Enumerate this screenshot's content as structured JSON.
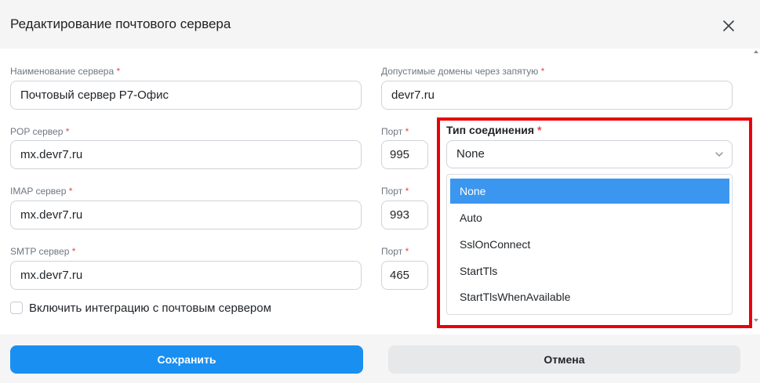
{
  "dialog": {
    "title": "Редактирование почтового сервера"
  },
  "form": {
    "server_name": {
      "label": "Наименование сервера",
      "value": "Почтовый сервер Р7-Офис"
    },
    "domains": {
      "label": "Допустимые домены через запятую",
      "value": "devr7.ru"
    },
    "pop": {
      "label": "POP сервер",
      "value": "mx.devr7.ru",
      "port_label": "Порт",
      "port": "995"
    },
    "imap": {
      "label": "IMAP сервер",
      "value": "mx.devr7.ru",
      "port_label": "Порт",
      "port": "993"
    },
    "smtp": {
      "label": "SMTP сервер",
      "value": "mx.devr7.ru",
      "port_label": "Порт",
      "port": "465"
    },
    "required_mark": "*",
    "connection_type": {
      "label": "Тип соединения",
      "selected": "None",
      "options": [
        "None",
        "Auto",
        "SslOnConnect",
        "StartTls",
        "StartTlsWhenAvailable"
      ]
    },
    "integration_checkbox": {
      "label": "Включить интеграцию с почтовым сервером",
      "checked": false
    }
  },
  "footer": {
    "save_label": "Сохранить",
    "cancel_label": "Отмена"
  },
  "colors": {
    "primary": "#1a8ff2",
    "dropdown_selected": "#3b96f0",
    "highlight": "#e8000a",
    "required": "#e5484d"
  }
}
